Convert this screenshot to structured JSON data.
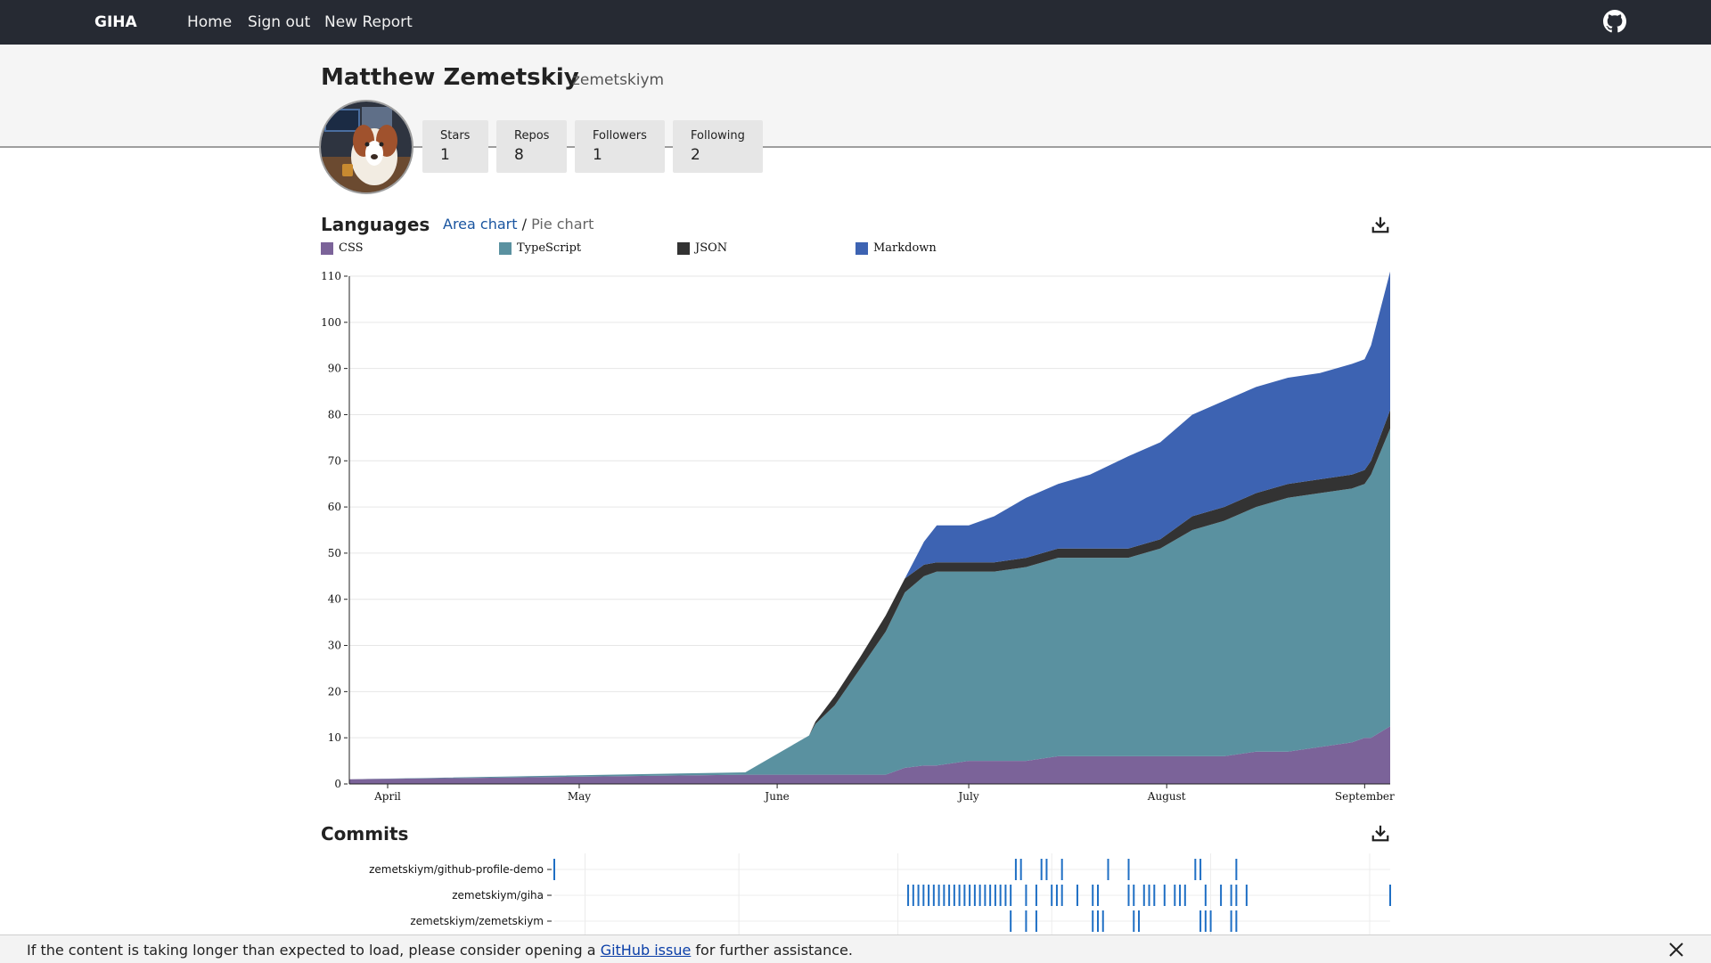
{
  "nav": {
    "brand": "GIHA",
    "links": [
      "Home",
      "Sign out",
      "New Report"
    ],
    "github_icon": "github-icon"
  },
  "profile": {
    "name": "Matthew Zemetskiy",
    "login": "zemetskiym",
    "avatar_icon": "avatar-photo",
    "stats": [
      {
        "label": "Stars",
        "value": "1"
      },
      {
        "label": "Repos",
        "value": "8"
      },
      {
        "label": "Followers",
        "value": "1"
      },
      {
        "label": "Following",
        "value": "2"
      }
    ]
  },
  "languages": {
    "title": "Languages",
    "switch_active": "Area chart",
    "switch_sep": "/",
    "switch_inactive": "Pie chart",
    "download_icon": "download-icon"
  },
  "commits": {
    "title": "Commits",
    "download_icon": "download-icon"
  },
  "notice": {
    "text_before": "If the content is taking longer than expected to load, please consider opening a ",
    "link": "GitHub issue",
    "text_after": " for further assistance.",
    "close_icon": "close-icon"
  },
  "colors": {
    "css": "#7b6399",
    "typescript": "#5a91a0",
    "json": "#333333",
    "markdown": "#3d63b2",
    "commit_tick": "#1f6fc4",
    "navbar": "#262a33"
  },
  "chart_data": [
    {
      "type": "area",
      "stacked": true,
      "x_axis": "date",
      "xticks": [
        "April",
        "May",
        "June",
        "July",
        "August",
        "September"
      ],
      "yticks": [
        0,
        10,
        20,
        30,
        40,
        50,
        60,
        70,
        80,
        90,
        100,
        110
      ],
      "ylim": [
        0,
        110
      ],
      "grid": true,
      "legend_position": "top-left",
      "x": [
        "2023-03-26",
        "2023-05-27",
        "2023-06-06",
        "2023-06-07",
        "2023-06-10",
        "2023-06-14",
        "2023-06-18",
        "2023-06-21",
        "2023-06-24",
        "2023-06-26",
        "2023-07-01",
        "2023-07-05",
        "2023-07-10",
        "2023-07-15",
        "2023-07-20",
        "2023-07-26",
        "2023-07-31",
        "2023-08-05",
        "2023-08-10",
        "2023-08-15",
        "2023-08-20",
        "2023-08-25",
        "2023-08-30",
        "2023-09-01",
        "2023-09-02",
        "2023-09-05"
      ],
      "series": [
        {
          "name": "CSS",
          "values": [
            1,
            2,
            2,
            2,
            2,
            2,
            2,
            3.5,
            4,
            4,
            5,
            5,
            5,
            6,
            6,
            6,
            6,
            6,
            6,
            7,
            7,
            8,
            9,
            10,
            10,
            12.5
          ]
        },
        {
          "name": "TypeScript",
          "values": [
            0,
            0.5,
            8.5,
            11,
            15,
            23,
            31,
            38,
            41,
            42,
            41,
            41,
            42,
            43,
            43,
            43,
            45,
            49,
            51,
            53,
            55,
            55,
            55,
            55,
            57,
            64.5
          ]
        },
        {
          "name": "JSON",
          "values": [
            0,
            0,
            0,
            0.5,
            2,
            2.5,
            3.5,
            3,
            2.5,
            2,
            2,
            2,
            2,
            2,
            2,
            2,
            2,
            3,
            3,
            3,
            3,
            3,
            3,
            3,
            3,
            4
          ]
        },
        {
          "name": "Markdown",
          "values": [
            0,
            0,
            0,
            0,
            0,
            0,
            0,
            0,
            5,
            8,
            8,
            10,
            13,
            14,
            16,
            20,
            21,
            22,
            23,
            23,
            23,
            23,
            24,
            24,
            25,
            30
          ]
        }
      ]
    },
    {
      "type": "scatter",
      "title": "Commits",
      "x_axis": "date",
      "categories": [
        "zemetskiym/github-profile-demo",
        "zemetskiym/giha",
        "zemetskiym/zemetskiym"
      ],
      "series": [
        {
          "name": "zemetskiym/github-profile-demo",
          "x": [
            "2023-03-26",
            "2023-06-24",
            "2023-06-25",
            "2023-06-29",
            "2023-06-30",
            "2023-07-03",
            "2023-07-12",
            "2023-07-16",
            "2023-07-29",
            "2023-07-30",
            "2023-08-06"
          ]
        },
        {
          "name": "zemetskiym/giha",
          "x": [
            "2023-06-03",
            "2023-06-04",
            "2023-06-05",
            "2023-06-06",
            "2023-06-07",
            "2023-06-08",
            "2023-06-09",
            "2023-06-10",
            "2023-06-11",
            "2023-06-12",
            "2023-06-13",
            "2023-06-14",
            "2023-06-15",
            "2023-06-16",
            "2023-06-17",
            "2023-06-18",
            "2023-06-19",
            "2023-06-20",
            "2023-06-21",
            "2023-06-22",
            "2023-06-23",
            "2023-06-26",
            "2023-06-28",
            "2023-07-01",
            "2023-07-02",
            "2023-07-03",
            "2023-07-06",
            "2023-07-09",
            "2023-07-10",
            "2023-07-16",
            "2023-07-17",
            "2023-07-19",
            "2023-07-20",
            "2023-07-21",
            "2023-07-23",
            "2023-07-25",
            "2023-07-26",
            "2023-07-27",
            "2023-07-31",
            "2023-08-03",
            "2023-08-05",
            "2023-08-06",
            "2023-08-08",
            "2023-09-05"
          ]
        },
        {
          "name": "zemetskiym/zemetskiym",
          "x": [
            "2023-06-23",
            "2023-06-26",
            "2023-06-28",
            "2023-07-09",
            "2023-07-10",
            "2023-07-11",
            "2023-07-17",
            "2023-07-18",
            "2023-07-30",
            "2023-07-31",
            "2023-08-01",
            "2023-08-05",
            "2023-08-06"
          ]
        }
      ]
    }
  ]
}
